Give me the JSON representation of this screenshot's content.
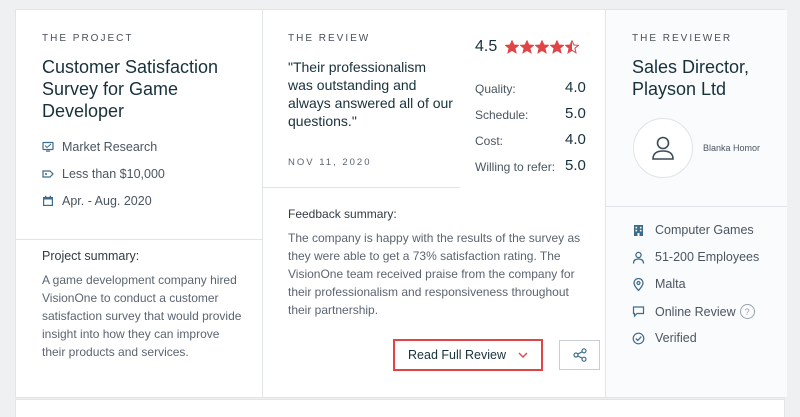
{
  "project": {
    "eyebrow": "THE PROJECT",
    "title": "Customer Satisfaction Survey for Game Developer",
    "service": "Market Research",
    "budget": "Less than $10,000",
    "dates": "Apr. - Aug. 2020",
    "summary_heading": "Project summary:",
    "summary_text": "A game development company hired VisionOne to conduct a customer satisfaction survey that would provide insight into how they can improve their products and services."
  },
  "review": {
    "eyebrow": "THE REVIEW",
    "quote": "\"Their professionalism was outstanding and always answered all of our questions.\"",
    "date": "NOV 11, 2020",
    "overall": "4.5",
    "stars_value": 4.5,
    "star_color": "#e04444",
    "scores": [
      {
        "label": "Quality:",
        "value": "4.0"
      },
      {
        "label": "Schedule:",
        "value": "5.0"
      },
      {
        "label": "Cost:",
        "value": "4.0"
      },
      {
        "label": "Willing to refer:",
        "value": "5.0"
      }
    ],
    "feedback_heading": "Feedback summary:",
    "feedback_text": "The company is happy with the results of the survey as they were able to get a 73%  satisfaction rating. The VisionOne team received praise from the company for their professionalism and responsiveness throughout their partnership.",
    "read_full_label": "Read Full Review"
  },
  "reviewer": {
    "eyebrow": "THE REVIEWER",
    "title": "Sales Director, Playson Ltd",
    "name": "Blanka Homor",
    "industry": "Computer Games",
    "size": "51-200 Employees",
    "location": "Malta",
    "review_type": "Online Review",
    "help": "?",
    "verified": "Verified"
  }
}
